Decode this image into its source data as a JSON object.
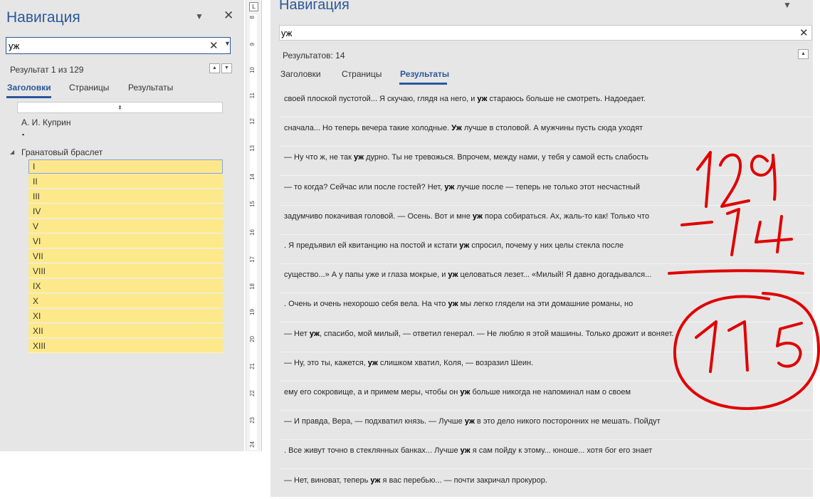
{
  "left_pane": {
    "title": "Навигация",
    "search_value": "уж",
    "result_text": "Результат 1 из 129",
    "tabs": [
      {
        "label": "Заголовки",
        "active": true
      },
      {
        "label": "Страницы",
        "active": false
      },
      {
        "label": "Результаты",
        "active": false
      }
    ],
    "tree": {
      "author": "А. И. Куприн",
      "bullet": "▪",
      "book": "Гранатовый браслет",
      "chapters": [
        "I",
        "II",
        "III",
        "IV",
        "V",
        "VI",
        "VII",
        "VIII",
        "IX",
        "X",
        "XI",
        "XII",
        "XIII"
      ]
    }
  },
  "ruler": {
    "numbers": [
      "8",
      "9",
      "10",
      "11",
      "12",
      "13",
      "14",
      "15",
      "16",
      "17",
      "18",
      "19",
      "20",
      "21",
      "22",
      "23",
      "24"
    ],
    "corner": "L"
  },
  "right_pane": {
    "title": "Навигация",
    "search_value": "уж",
    "results_count": "Результатов: 14",
    "tabs": [
      {
        "label": "Заголовки",
        "active": false
      },
      {
        "label": "Страницы",
        "active": false
      },
      {
        "label": "Результаты",
        "active": true
      }
    ],
    "results": [
      {
        "pre": "своей плоской пустотой... Я скучаю, глядя на него, и ",
        "match": "уж",
        "post": " стараюсь больше не смотреть. Надоедает."
      },
      {
        "pre": "сначала... Но теперь вечера такие холодные. ",
        "match": "Уж",
        "post": " лучше в столовой. А мужчины пусть сюда уходят"
      },
      {
        "pre": "— Ну что ж, не так ",
        "match": "уж",
        "post": " дурно. Ты не тревожься. Впрочем, между нами, у тебя у самой есть слабость"
      },
      {
        "pre": "— то когда? Сейчас или после гостей? Нет, ",
        "match": "уж",
        "post": " лучше после — теперь не только этот несчастный"
      },
      {
        "pre": "задумчиво покачивая головой. — Осень. Вот и мне ",
        "match": "уж",
        "post": " пора собираться. Ах, жаль-то как! Только что"
      },
      {
        "pre": ". Я предъявил ей квитанцию на постой и кстати ",
        "match": "уж",
        "post": " спросил, почему у них целы стекла после"
      },
      {
        "pre": "существо...» А у папы уже и глаза мокрые, и ",
        "match": "уж",
        "post": " целоваться лезет... «Милый! Я давно догадывался..."
      },
      {
        "pre": ". Очень и очень нехорошо себя вела. На что ",
        "match": "уж",
        "post": " мы легко глядели на эти домашние романы, но"
      },
      {
        "pre": "— Нет ",
        "match": "уж",
        "post": ", спасибо, мой милый, — ответил генерал. — Не люблю я этой машины. Только дрожит и воняет."
      },
      {
        "pre": "— Ну, это ты, кажется, ",
        "match": "уж",
        "post": " слишком хватил, Коля, — возразил Шеин."
      },
      {
        "pre": "ему его сокровище, а и примем меры, чтобы он ",
        "match": "уж",
        "post": " больше никогда не напоминал нам о своем"
      },
      {
        "pre": "— И правда, Вера, — подхватил князь. — Лучше ",
        "match": "уж",
        "post": " в это дело никого посторонних не мешать. Пойдут"
      },
      {
        "pre": ". Все живут точно в стеклянных банках... Лучше ",
        "match": "уж",
        "post": " я сам пойду к этому... юноше... хотя бог его знает"
      },
      {
        "pre": "— Нет, виноват, теперь ",
        "match": "уж",
        "post": " я вас перебью... — почти закричал прокурор."
      }
    ]
  },
  "icons": {
    "close": "close-icon",
    "clear": "clear-search-icon",
    "dropdown": "chevron-down-icon",
    "prev": "arrow-up-icon",
    "next": "arrow-down-icon"
  },
  "colors": {
    "accent": "#2b579a",
    "highlight": "#fde98a",
    "annotation": "#e00000"
  },
  "annotation": {
    "line1": "129",
    "line2": "-14",
    "result": "115"
  }
}
